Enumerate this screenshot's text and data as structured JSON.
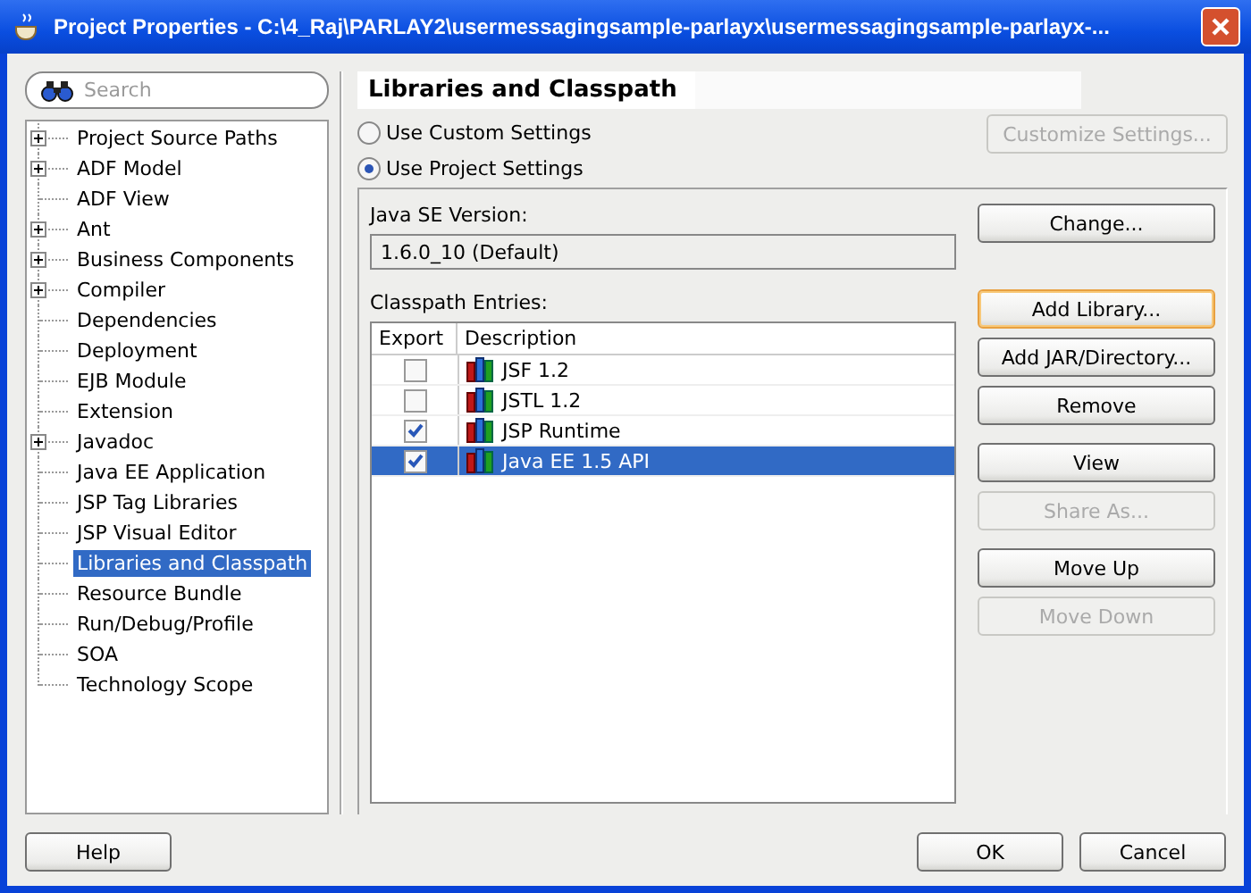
{
  "window": {
    "title": "Project Properties - C:\\4_Raj\\PARLAY2\\usermessagingsample-parlayx\\usermessagingsample-parlayx-..."
  },
  "search": {
    "placeholder": "Search"
  },
  "tree": [
    {
      "label": "Project Source Paths",
      "expandable": true,
      "selected": false
    },
    {
      "label": "ADF Model",
      "expandable": true,
      "selected": false
    },
    {
      "label": "ADF View",
      "expandable": false,
      "selected": false
    },
    {
      "label": "Ant",
      "expandable": true,
      "selected": false
    },
    {
      "label": "Business Components",
      "expandable": true,
      "selected": false
    },
    {
      "label": "Compiler",
      "expandable": true,
      "selected": false
    },
    {
      "label": "Dependencies",
      "expandable": false,
      "selected": false
    },
    {
      "label": "Deployment",
      "expandable": false,
      "selected": false
    },
    {
      "label": "EJB Module",
      "expandable": false,
      "selected": false
    },
    {
      "label": "Extension",
      "expandable": false,
      "selected": false
    },
    {
      "label": "Javadoc",
      "expandable": true,
      "selected": false
    },
    {
      "label": "Java EE Application",
      "expandable": false,
      "selected": false
    },
    {
      "label": "JSP Tag Libraries",
      "expandable": false,
      "selected": false
    },
    {
      "label": "JSP Visual Editor",
      "expandable": false,
      "selected": false
    },
    {
      "label": "Libraries and Classpath",
      "expandable": false,
      "selected": true
    },
    {
      "label": "Resource Bundle",
      "expandable": false,
      "selected": false
    },
    {
      "label": "Run/Debug/Profile",
      "expandable": false,
      "selected": false
    },
    {
      "label": "SOA",
      "expandable": false,
      "selected": false
    },
    {
      "label": "Technology Scope",
      "expandable": false,
      "selected": false
    }
  ],
  "page_title": "Libraries and Classpath",
  "radios": [
    {
      "label": "Use Custom Settings",
      "selected": false
    },
    {
      "label": "Use Project Settings",
      "selected": true
    }
  ],
  "customize_button": {
    "label": "Customize Settings...",
    "disabled": true
  },
  "java_se": {
    "label": "Java SE Version:",
    "value": "1.6.0_10 (Default)",
    "button": "Change..."
  },
  "classpath": {
    "label": "Classpath Entries:",
    "columns": [
      "Export",
      "Description"
    ],
    "rows": [
      {
        "name": "JSF 1.2",
        "checked": false,
        "selected": false
      },
      {
        "name": "JSTL 1.2",
        "checked": false,
        "selected": false
      },
      {
        "name": "JSP Runtime",
        "checked": true,
        "selected": false
      },
      {
        "name": "Java EE 1.5 API",
        "checked": true,
        "selected": true
      }
    ]
  },
  "side_button_groups": [
    [
      {
        "label": "Add Library...",
        "disabled": false,
        "focused": true
      },
      {
        "label": "Add JAR/Directory...",
        "disabled": false,
        "focused": false
      },
      {
        "label": "Remove",
        "disabled": false,
        "focused": false
      }
    ],
    [
      {
        "label": "View",
        "disabled": false,
        "focused": false
      },
      {
        "label": "Share As...",
        "disabled": true,
        "focused": false
      }
    ],
    [
      {
        "label": "Move Up",
        "disabled": false,
        "focused": false
      },
      {
        "label": "Move Down",
        "disabled": true,
        "focused": false
      }
    ]
  ],
  "footer": {
    "help": "Help",
    "ok": "OK",
    "cancel": "Cancel"
  }
}
